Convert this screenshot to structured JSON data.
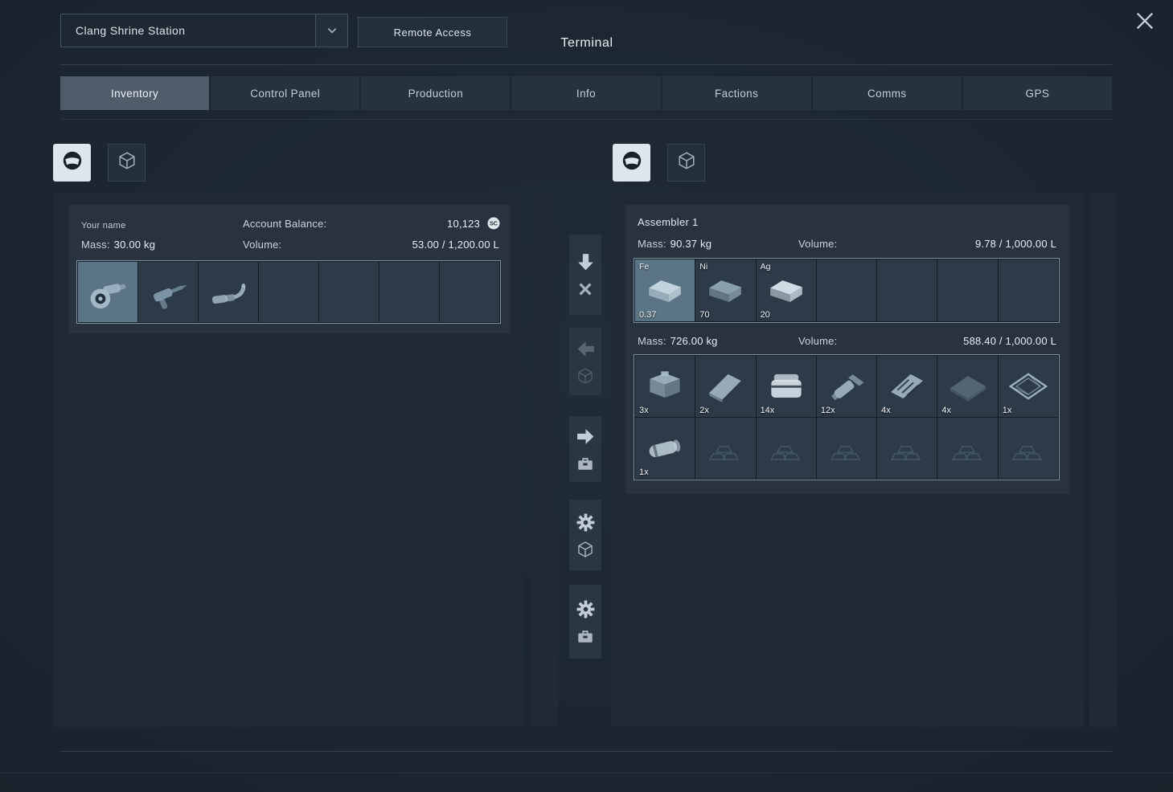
{
  "window": {
    "station_name": "Clang Shrine Station",
    "remote_access_label": "Remote Access",
    "title": "Terminal"
  },
  "tabs": [
    {
      "label": "Inventory",
      "active": true
    },
    {
      "label": "Control Panel",
      "active": false
    },
    {
      "label": "Production",
      "active": false
    },
    {
      "label": "Info",
      "active": false
    },
    {
      "label": "Factions",
      "active": false
    },
    {
      "label": "Comms",
      "active": false
    },
    {
      "label": "GPS",
      "active": false
    }
  ],
  "filters": {
    "left": [
      "character-helmet",
      "block-cube"
    ],
    "right": [
      "character-helmet",
      "block-cube"
    ]
  },
  "player_inventory": {
    "owner": "Your name",
    "account_balance_label": "Account Balance:",
    "account_balance_value": "10,123",
    "currency_icon": "space-credit-coin",
    "mass_label": "Mass:",
    "mass_value": "30.00 kg",
    "volume_label": "Volume:",
    "volume_value": "53.00 / 1,200.00 L",
    "slots": [
      {
        "icon": "angle-grinder",
        "selected": true
      },
      {
        "icon": "hand-drill"
      },
      {
        "icon": "welder"
      },
      {},
      {},
      {},
      {}
    ]
  },
  "assembler_inventory": {
    "title": "Assembler 1",
    "input": {
      "mass_label": "Mass:",
      "mass_value": "90.37 kg",
      "volume_label": "Volume:",
      "volume_value": "9.78 / 1,000.00 L",
      "slots": [
        {
          "icon": "iron-ingot",
          "tag": "Fe",
          "qty": "0.37",
          "selected": true
        },
        {
          "icon": "nickel-ingot",
          "tag": "Ni",
          "qty": "70"
        },
        {
          "icon": "silver-ingot",
          "tag": "Ag",
          "qty": "20"
        },
        {},
        {},
        {},
        {}
      ]
    },
    "output": {
      "mass_label": "Mass:",
      "mass_value": "726.00 kg",
      "volume_label": "Volume:",
      "volume_value": "588.40 / 1,000.00 L",
      "slots": [
        {
          "icon": "component-crate",
          "qty": "3x"
        },
        {
          "icon": "steel-plate",
          "qty": "2x"
        },
        {
          "icon": "container-box",
          "qty": "14x"
        },
        {
          "icon": "thruster-part",
          "qty": "12x"
        },
        {
          "icon": "circuit-board",
          "qty": "4x"
        },
        {
          "icon": "flat-panel",
          "qty": "4x"
        },
        {
          "icon": "metal-grid",
          "qty": "1x"
        },
        {
          "icon": "large-tube",
          "qty": "1x"
        },
        {
          "icon": "ingot-stack-ghost",
          "ghost": true
        },
        {
          "icon": "ingot-stack-ghost",
          "ghost": true
        },
        {
          "icon": "ingot-stack-ghost",
          "ghost": true
        },
        {
          "icon": "ingot-stack-ghost",
          "ghost": true
        },
        {
          "icon": "ingot-stack-ghost",
          "ghost": true
        },
        {
          "icon": "ingot-stack-ghost",
          "ghost": true
        }
      ]
    }
  },
  "transfer_buttons": [
    {
      "name": "throw-out",
      "icons": [
        "arrow-down",
        "x-mark"
      ],
      "enabled": true
    },
    {
      "name": "transfer-to-left-inventory",
      "icons": [
        "arrow-left",
        "block-cube"
      ],
      "enabled": false
    },
    {
      "name": "transfer-to-right-inventory",
      "icons": [
        "arrow-right",
        "container"
      ],
      "enabled": true
    },
    {
      "name": "auto-sort-block",
      "icons": [
        "gear",
        "block-cube"
      ],
      "enabled": true
    },
    {
      "name": "auto-sort-container",
      "icons": [
        "gear",
        "container"
      ],
      "enabled": true
    }
  ]
}
